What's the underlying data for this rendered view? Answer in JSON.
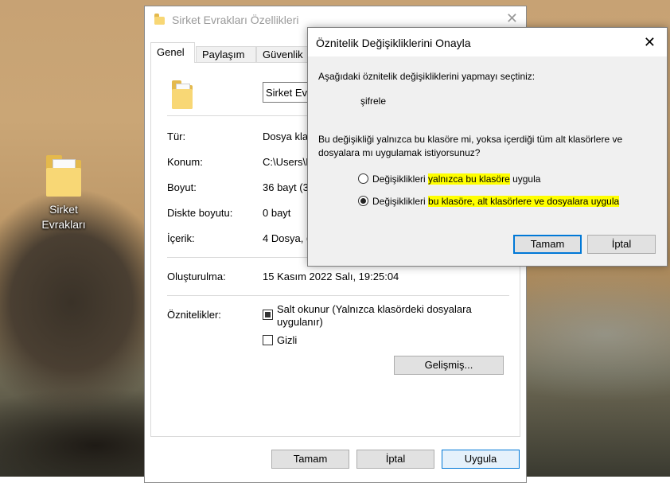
{
  "desktop": {
    "icon_label": "Sirket Evrakları"
  },
  "properties": {
    "title": "Sirket Evrakları Özellikleri",
    "tabs": [
      "Genel",
      "Paylaşım",
      "Güvenlik"
    ],
    "name_value": "Sirket Evr",
    "rows": {
      "type_label": "Tür:",
      "type_value": "Dosya kla",
      "location_label": "Konum:",
      "location_value": "C:\\Users\\I",
      "size_label": "Boyut:",
      "size_value": "36 bayt (36",
      "disk_size_label": "Diskte boyutu:",
      "disk_size_value": "0 bayt",
      "contents_label": "İçerik:",
      "contents_value": "4 Dosya, (",
      "created_label": "Oluşturulma:",
      "created_value": "15 Kasım 2022 Salı, 19:25:04",
      "attributes_label": "Öznitelikler:"
    },
    "readonly_label": "Salt okunur (Yalnızca klasördeki dosyalara uygulanır)",
    "hidden_label": "Gizli",
    "advanced_button": "Gelişmiş...",
    "ok_button": "Tamam",
    "cancel_button": "İptal",
    "apply_button": "Uygula"
  },
  "confirm": {
    "title": "Öznitelik Değişikliklerini Onayla",
    "intro": "Aşağıdaki öznitelik değişikliklerini yapmayı seçtiniz:",
    "change": "şifrele",
    "question": "Bu değişikliği yalnızca bu klasöre mi, yoksa içerdiği tüm alt klasörlere ve dosyalara mı uygulamak istiyorsunuz?",
    "option1": {
      "pre": "Değişiklikleri ",
      "hl": "yalnızca bu klasöre",
      "post": " uygula",
      "selected": false
    },
    "option2": {
      "pre": "Değişiklikleri ",
      "hl1": "bu klasöre",
      "mid": ", ",
      "hl2": "alt klasörlere ve dosyalara uygula",
      "selected": true
    },
    "ok_button": "Tamam",
    "cancel_button": "İptal"
  },
  "colors": {
    "highlight": "#ffff00",
    "accent": "#0078d7",
    "folder": "#f8d775"
  }
}
